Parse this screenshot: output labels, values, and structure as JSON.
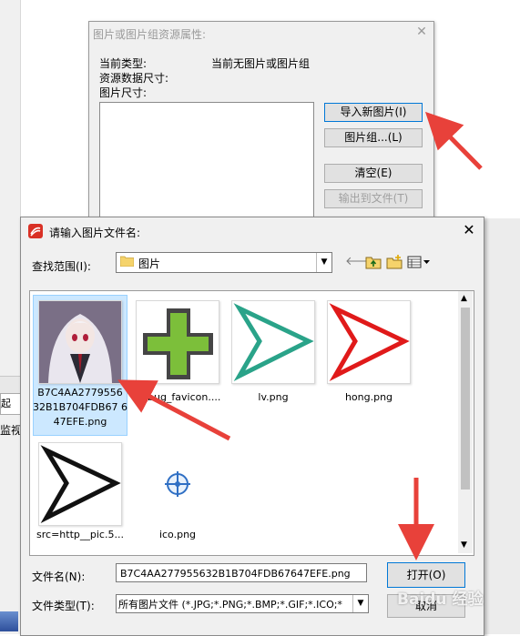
{
  "background": {
    "tab_label": "起",
    "monitor_label": "监视"
  },
  "resource_dialog": {
    "title": "图片或图片组资源属性:",
    "current_type_label": "当前类型:",
    "current_type_value": "当前无图片或图片组",
    "resource_size_label": "资源数据尺寸:",
    "image_size_label": "图片尺寸:",
    "buttons": {
      "import": "导入新图片(I)",
      "image_group": "图片组...(L)",
      "clear": "清空(E)",
      "export": "输出到文件(T)"
    }
  },
  "open_dialog": {
    "title": "请输入图片文件名:",
    "look_in_label": "查找范围(I):",
    "look_in_value": "图片",
    "files": [
      {
        "name": "B7C4AA2779556 32B1B704FDB67 647EFE.png",
        "icon": "anime-girl-thumbnail",
        "selected": true
      },
      {
        "name": "bitbug_favicon....",
        "icon": "green-plus-icon",
        "selected": false
      },
      {
        "name": "lv.png",
        "icon": "green-arrow-cursor-icon",
        "selected": false
      },
      {
        "name": "hong.png",
        "icon": "red-arrow-cursor-icon",
        "selected": false
      },
      {
        "name": "src=http__pic.5...",
        "icon": "black-arrow-cursor-icon",
        "selected": false
      },
      {
        "name": "ico.png",
        "icon": "blue-crosshair-icon",
        "selected": false
      }
    ],
    "filename_label": "文件名(N):",
    "filename_value": "B7C4AA277955632B1B704FDB67647EFE.png",
    "filetype_label": "文件类型(T):",
    "filetype_value": "所有图片文件 (*.JPG;*.PNG;*.BMP;*.GIF;*.ICO;*",
    "open_button": "打开(O)",
    "cancel_button": "取消"
  },
  "watermark": "Baidu 经验",
  "colors": {
    "annotation_arrow": "#e8413a",
    "selection": "#cce8ff",
    "focus_border": "#0078d7"
  }
}
